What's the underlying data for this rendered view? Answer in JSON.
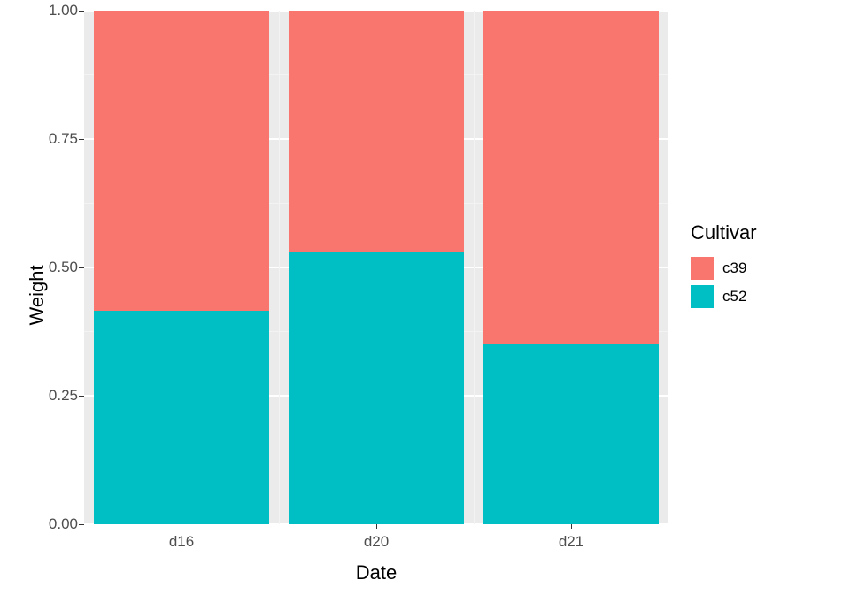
{
  "chart_data": {
    "type": "bar",
    "stacked": true,
    "fill_mode": "proportion",
    "categories": [
      "d16",
      "d20",
      "d21"
    ],
    "series": [
      {
        "name": "c39",
        "color": "#F8766D",
        "values": [
          0.585,
          0.47,
          0.65
        ]
      },
      {
        "name": "c52",
        "color": "#00BFC4",
        "values": [
          0.415,
          0.53,
          0.35
        ]
      }
    ],
    "xlabel": "Date",
    "ylabel": "Weight",
    "legend_title": "Cultivar",
    "ylim": [
      0,
      1
    ],
    "y_ticks": [
      0.0,
      0.25,
      0.5,
      0.75,
      1.0
    ],
    "y_tick_labels": [
      "0.00",
      "0.25",
      "0.50",
      "0.75",
      "1.00"
    ]
  }
}
